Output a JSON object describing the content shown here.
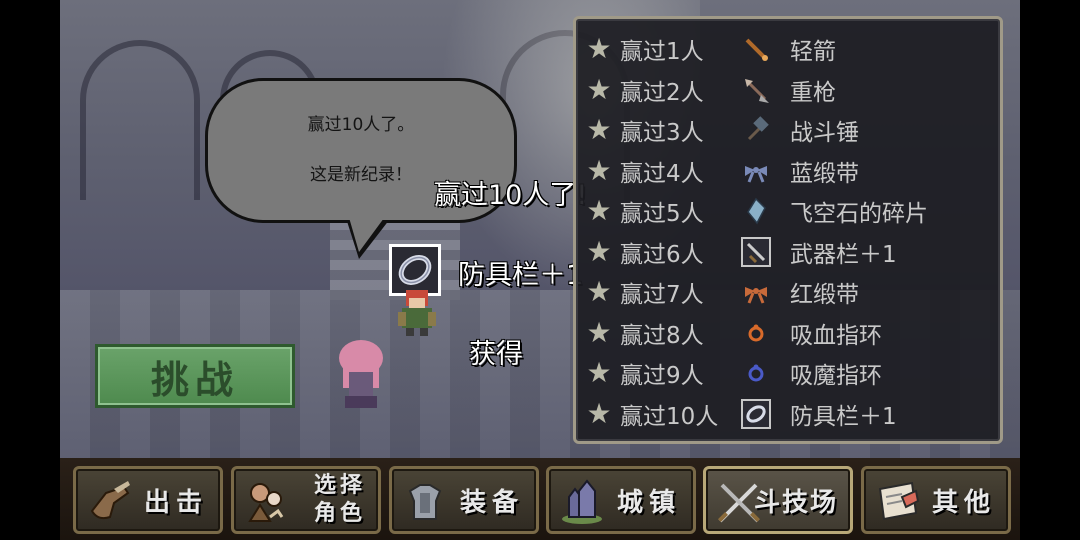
{
  "dialog": {
    "line1": "赢过10人了。",
    "line2": "这是新纪录！"
  },
  "announcement": {
    "win_text": "赢过10人了!",
    "reward_name": "防具栏＋1",
    "obtained": "获得",
    "reward_icon": "ring-icon"
  },
  "challenge_button": {
    "label": "挑战"
  },
  "reward_list": [
    {
      "label": "赢过1人",
      "item": "轻箭",
      "icon": "arrow-icon",
      "color": "#b06a2a"
    },
    {
      "label": "赢过2人",
      "item": "重枪",
      "icon": "spear-icon",
      "color": "#8a6a5a"
    },
    {
      "label": "赢过3人",
      "item": "战斗锤",
      "icon": "hammer-icon",
      "color": "#5a6a7a"
    },
    {
      "label": "赢过4人",
      "item": "蓝缎带",
      "icon": "ribbon-icon",
      "color": "#7a8ab8"
    },
    {
      "label": "赢过5人",
      "item": "飞空石的碎片",
      "icon": "crystal-icon",
      "color": "#8ab0c8"
    },
    {
      "label": "赢过6人",
      "item": "武器栏＋1",
      "icon": "sword-slot-icon",
      "color": "#c8c8c8"
    },
    {
      "label": "赢过7人",
      "item": "红缎带",
      "icon": "ribbon-icon",
      "color": "#c86a3a"
    },
    {
      "label": "赢过8人",
      "item": "吸血指环",
      "icon": "ring-icon",
      "color": "#d86a2a"
    },
    {
      "label": "赢过9人",
      "item": "吸魔指环",
      "icon": "ring-icon",
      "color": "#4a5ac8"
    },
    {
      "label": "赢过10人",
      "item": "防具栏＋1",
      "icon": "armor-slot-icon",
      "color": "#c8c8c8"
    }
  ],
  "bottom_nav": [
    {
      "label": "出击",
      "icon": "boot-icon",
      "two_line": false
    },
    {
      "label_line1": "选择",
      "label_line2": "角色",
      "icon": "character-select-icon",
      "two_line": true
    },
    {
      "label": "装备",
      "icon": "armor-icon",
      "two_line": false
    },
    {
      "label": "城镇",
      "icon": "town-icon",
      "two_line": false
    },
    {
      "label": "斗技场",
      "icon": "crossed-swords-icon",
      "two_line": false,
      "active": true
    },
    {
      "label": "其他",
      "icon": "scroll-icon",
      "two_line": false
    }
  ],
  "colors": {
    "challenge_green": "#4e8a4e",
    "panel_border": "#a09a88",
    "star_gray": "#b8b8a8"
  }
}
